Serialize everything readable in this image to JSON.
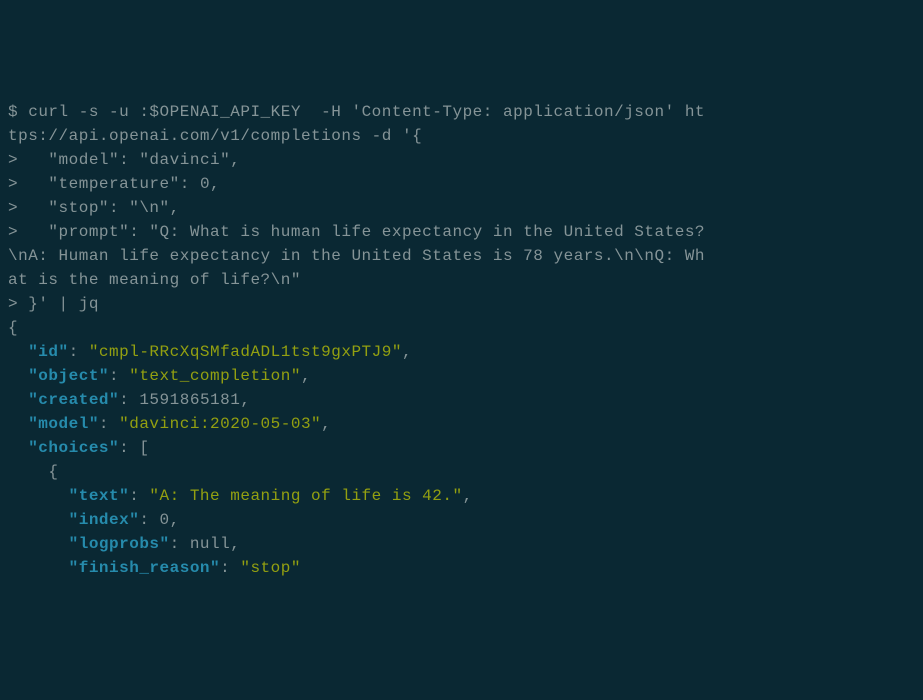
{
  "cmd": {
    "prompt": "$",
    "line1": " curl -s -u :$OPENAI_API_KEY  -H 'Content-Type: application/json' ht",
    "line2": "tps://api.openai.com/v1/completions -d '{",
    "cont": ">",
    "body1": "   \"model\": \"davinci\",",
    "body2": "   \"temperature\": 0,",
    "body3": "   \"stop\": \"\\n\",",
    "body4": "   \"prompt\": \"Q: What is human life expectancy in the United States?",
    "body5": "\\nA: Human life expectancy in the United States is 78 years.\\n\\nQ: Wh",
    "body6": "at is the meaning of life?\\n\"",
    "body7": " }' | jq"
  },
  "response": {
    "id_key": "\"id\"",
    "id_val": "\"cmpl-RRcXqSMfadADL1tst9gxPTJ9\"",
    "object_key": "\"object\"",
    "object_val": "\"text_completion\"",
    "created_key": "\"created\"",
    "created_val": "1591865181",
    "model_key": "\"model\"",
    "model_val": "\"davinci:2020-05-03\"",
    "choices_key": "\"choices\"",
    "text_key": "\"text\"",
    "text_val": "\"A: The meaning of life is 42.\"",
    "index_key": "\"index\"",
    "index_val": "0",
    "logprobs_key": "\"logprobs\"",
    "logprobs_val": "null",
    "finish_reason_key": "\"finish_reason\"",
    "finish_reason_val": "\"stop\""
  }
}
